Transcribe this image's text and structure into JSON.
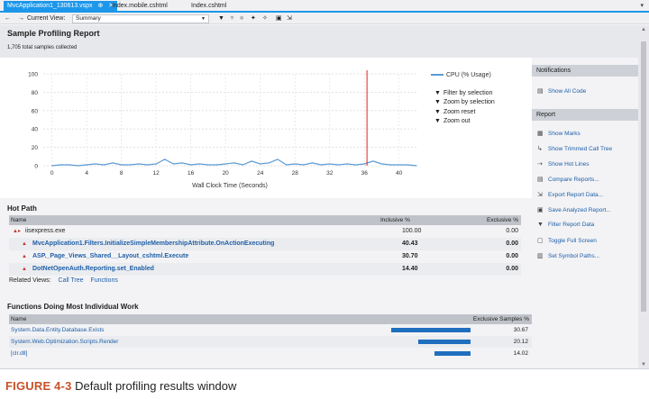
{
  "tabs": [
    {
      "label": "MvcApplication1_130613.vspx",
      "pin": "⊕",
      "close": "✕"
    },
    {
      "label": "Index.mobile.cshtml"
    },
    {
      "label": "Index.cshtml"
    }
  ],
  "tab_menu": "▾",
  "toolbar": {
    "nav": "← →",
    "current_view_label": "Current View:",
    "current_view_value": "Summary"
  },
  "report": {
    "title": "Sample Profiling Report",
    "subtitle": "1,705 total samples collected"
  },
  "chart_data": {
    "type": "line",
    "series": [
      {
        "name": "CPU (% Usage)",
        "color": "#5b9bd5",
        "x": [
          0,
          1,
          2,
          3,
          4,
          5,
          6,
          7,
          8,
          9,
          10,
          11,
          12,
          13,
          14,
          15,
          16,
          17,
          18,
          19,
          20,
          21,
          22,
          23,
          24,
          25,
          26,
          27,
          28,
          29,
          30,
          31,
          32,
          33,
          34,
          35,
          36,
          37,
          38,
          39,
          40,
          41,
          42
        ],
        "values": [
          0,
          1,
          1,
          0,
          1,
          2,
          1,
          3,
          1,
          1,
          2,
          1,
          2,
          7,
          2,
          3,
          1,
          2,
          1,
          1,
          2,
          3,
          1,
          5,
          2,
          3,
          7,
          1,
          2,
          1,
          3,
          1,
          2,
          1,
          2,
          1,
          2,
          5,
          2,
          1,
          1,
          1,
          0
        ]
      }
    ],
    "xlabel": "Wall Clock Time (Seconds)",
    "ylabel": "",
    "xticks": [
      0,
      4,
      8,
      12,
      16,
      20,
      24,
      28,
      32,
      36,
      40
    ],
    "yticks": [
      0,
      20,
      40,
      60,
      80,
      100
    ],
    "xlim": [
      -1,
      42
    ],
    "ylim": [
      0,
      100
    ],
    "marker_x": 36.3,
    "marker_color": "#e02020",
    "grid": true
  },
  "chart_actions": [
    {
      "icon": "filter-icon",
      "label": "Filter by selection"
    },
    {
      "icon": "zoom-selection-icon",
      "label": "Zoom by selection"
    },
    {
      "icon": "zoom-reset-icon",
      "label": "Zoom reset"
    },
    {
      "icon": "zoom-out-icon",
      "label": "Zoom out"
    }
  ],
  "hot_path": {
    "title": "Hot Path",
    "columns": [
      "Name",
      "Inclusive %",
      "Exclusive %"
    ],
    "rows": [
      {
        "name": "iisexpress.exe",
        "inclusive": "100.00",
        "exclusive": "0.00",
        "link": false
      },
      {
        "name": "MvcApplication1.Filters.InitializeSimpleMembershipAttribute.OnActionExecuting",
        "inclusive": "40.43",
        "exclusive": "0.00",
        "link": true
      },
      {
        "name": "ASP._Page_Views_Shared__Layout_cshtml.Execute",
        "inclusive": "30.70",
        "exclusive": "0.00",
        "link": true
      },
      {
        "name": "DotNetOpenAuth.Reporting.set_Enabled",
        "inclusive": "14.40",
        "exclusive": "0.00",
        "link": true
      }
    ]
  },
  "related": {
    "label": "Related Views:",
    "links": [
      "Call Tree",
      "Functions"
    ]
  },
  "functions": {
    "title": "Functions Doing Most Individual Work",
    "columns": [
      "Name",
      "Exclusive Samples %"
    ],
    "rows": [
      {
        "name": "System.Data.Entity.Database.Exists",
        "value": 30.67,
        "display": "30.67"
      },
      {
        "name": "System.Web.Optimization.Scripts.Render",
        "value": 20.12,
        "display": "20.12"
      },
      {
        "name": "[clr.dll]",
        "value": 14.02,
        "display": "14.02"
      }
    ],
    "bar_color": "#1f6fbf"
  },
  "panel": {
    "notifications_title": "Notifications",
    "notifications": [
      {
        "icon": "code-icon",
        "label": "Show All Code"
      }
    ],
    "report_title": "Report",
    "report_items": [
      {
        "icon": "marks-icon",
        "label": "Show Marks"
      },
      {
        "icon": "trimmed-tree-icon",
        "label": "Show Trimmed Call Tree"
      },
      {
        "icon": "hot-lines-icon",
        "label": "Show Hot Lines"
      },
      {
        "icon": "compare-icon",
        "label": "Compare Reports..."
      },
      {
        "icon": "export-icon",
        "label": "Export Report Data..."
      },
      {
        "icon": "save-icon",
        "label": "Save Analyzed Report..."
      },
      {
        "icon": "filter-icon",
        "label": "Filter Report Data"
      },
      {
        "icon": "fullscreen-icon",
        "label": "Toggle Full Screen"
      },
      {
        "icon": "symbol-paths-icon",
        "label": "Set Symbol Paths..."
      }
    ]
  },
  "caption": {
    "figure": "FIGURE 4-3",
    "text": "Default profiling results window"
  }
}
